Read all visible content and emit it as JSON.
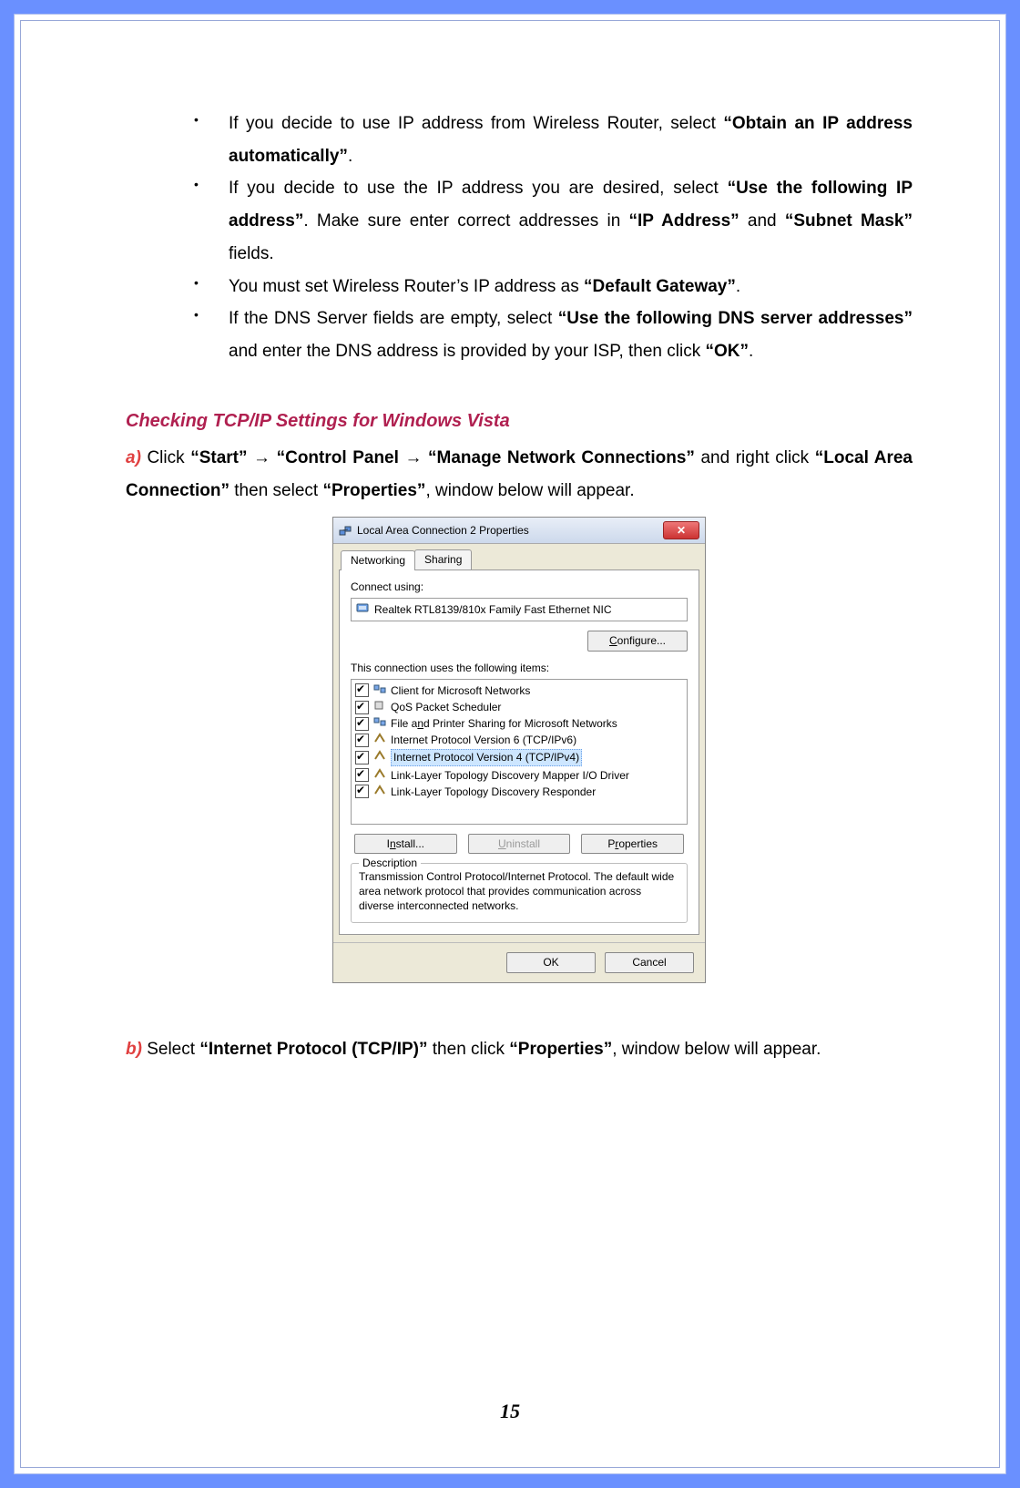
{
  "bullets": [
    {
      "pre": "If you decide to use IP address from Wireless Router, select ",
      "b1": "“Obtain an IP address automatically”",
      "post": "."
    },
    {
      "pre": "If you decide to use the IP address you are desired, select ",
      "b1": "“Use the following IP address”",
      "mid": ". Make sure enter correct addresses in ",
      "b2": "“IP Address”",
      "mid2": " and ",
      "b3": "“Subnet Mask”",
      "post": " fields."
    },
    {
      "pre": "You must set Wireless Router’s IP address as ",
      "b1": "“Default Gateway”",
      "post": "."
    },
    {
      "pre": "If the DNS Server fields are empty, select ",
      "b1": "“Use the following DNS server addresses”",
      "mid": " and enter the DNS address is provided by your ISP, then click ",
      "b2": "“OK”",
      "post": "."
    }
  ],
  "section_title": "Checking TCP/IP Settings for Windows Vista",
  "step_a": {
    "marker": "a)",
    "t1": " Click ",
    "b1": "“Start”",
    "arr": " → ",
    "b2": "“Control Panel",
    "arr2": " →  ",
    "b3": "“Manage Network Connections”",
    "t2": " and right click ",
    "b4": "“Local Area Connection”",
    "t3": " then select ",
    "b5": "“Properties”",
    "t4": ", window below will appear."
  },
  "dialog": {
    "title": "Local Area Connection 2 Properties",
    "tabs": [
      "Networking",
      "Sharing"
    ],
    "connect_label": "Connect using:",
    "adapter": "Realtek RTL8139/810x Family Fast Ethernet NIC",
    "configure": "Configure...",
    "items_label": "This connection uses the following items:",
    "items": [
      "Client for Microsoft Networks",
      "QoS Packet Scheduler",
      "File and Printer Sharing for Microsoft Networks",
      "Internet Protocol Version 6 (TCP/IPv6)",
      "Internet Protocol Version 4 (TCP/IPv4)",
      "Link-Layer Topology Discovery Mapper I/O Driver",
      "Link-Layer Topology Discovery Responder"
    ],
    "install": "Install...",
    "uninstall": "Uninstall",
    "properties": "Properties",
    "desc_label": "Description",
    "desc_text": "Transmission Control Protocol/Internet Protocol. The default wide area network protocol that provides communication across diverse interconnected networks.",
    "ok": "OK",
    "cancel": "Cancel"
  },
  "step_b": {
    "marker": "b)",
    "t1": " Select ",
    "b1": "“Internet Protocol (TCP/IP)”",
    "t2": " then click ",
    "b2": "“Properties”",
    "t3": ", window below will appear."
  },
  "page_number": "15"
}
